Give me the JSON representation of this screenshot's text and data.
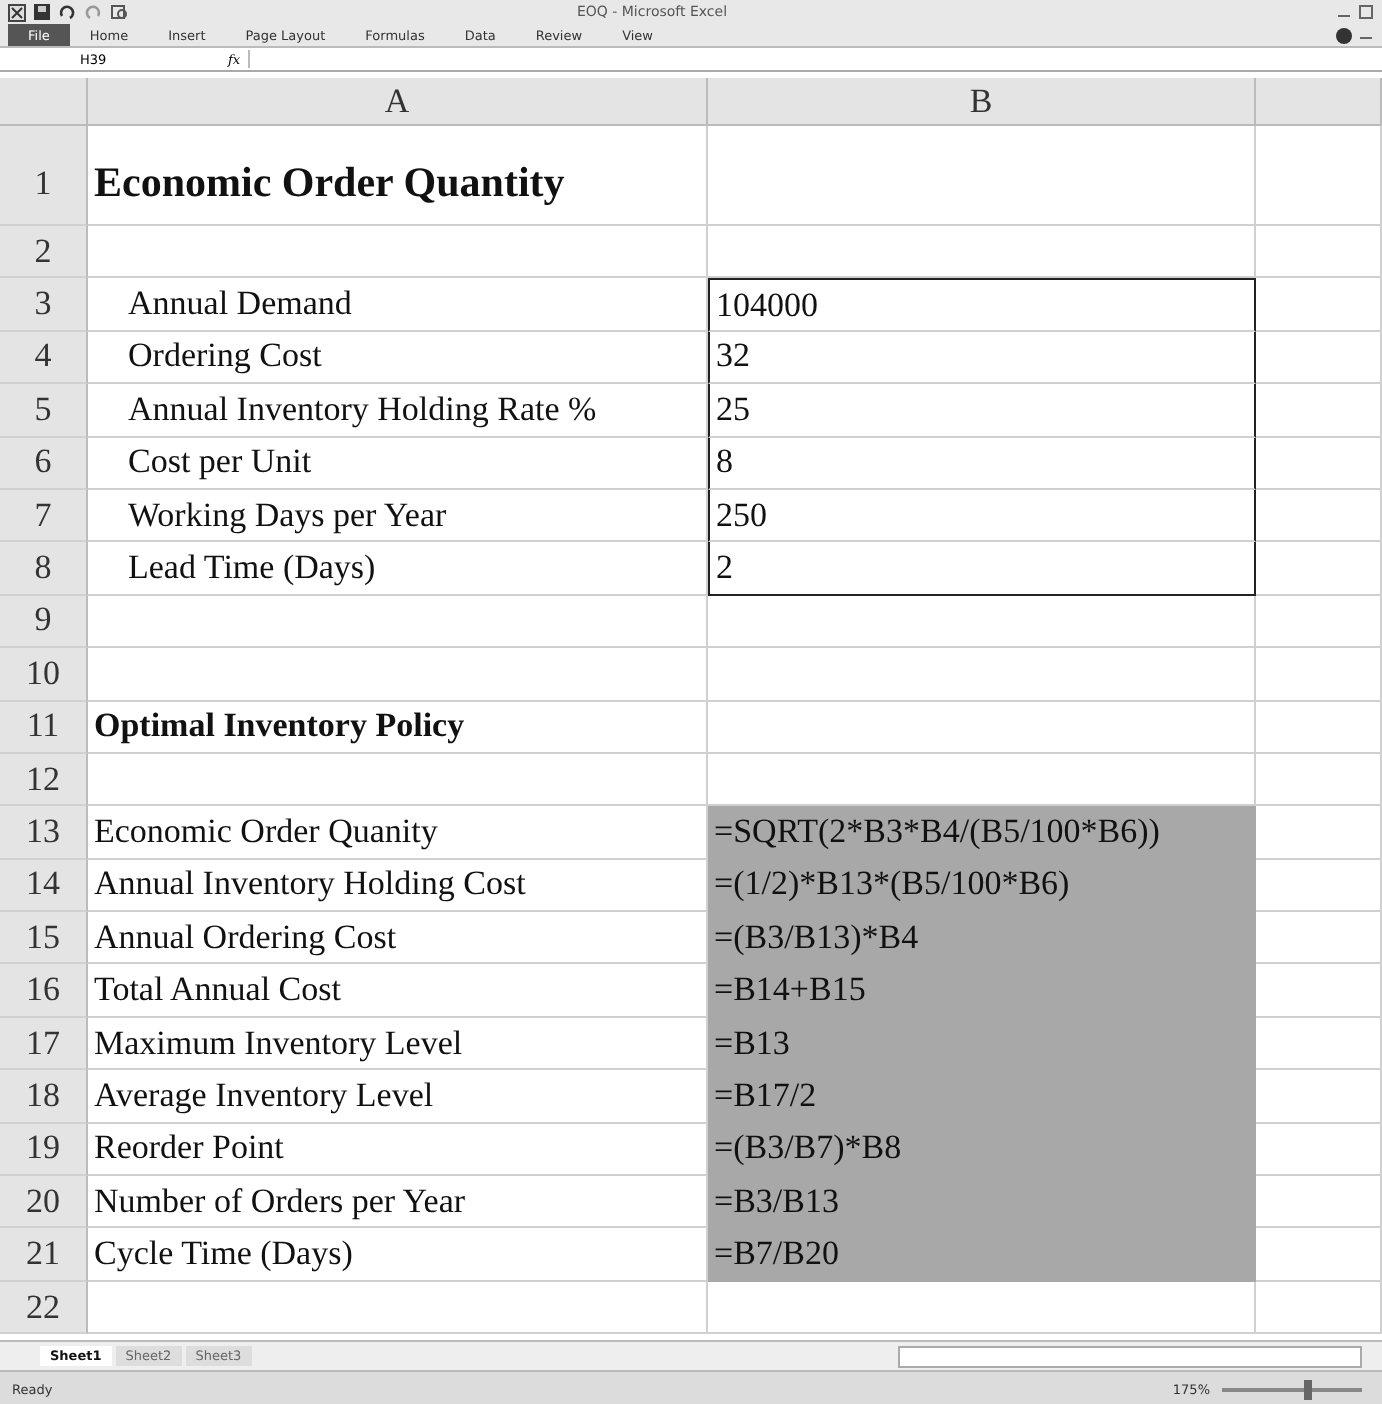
{
  "window": {
    "title": "EOQ - Microsoft Excel"
  },
  "ribbon_tabs": [
    {
      "label": "File",
      "selected": true
    },
    {
      "label": "Home",
      "selected": false
    },
    {
      "label": "Insert",
      "selected": false
    },
    {
      "label": "Page Layout",
      "selected": false
    },
    {
      "label": "Formulas",
      "selected": false
    },
    {
      "label": "Data",
      "selected": false
    },
    {
      "label": "Review",
      "selected": false
    },
    {
      "label": "View",
      "selected": false
    }
  ],
  "formula_bar": {
    "name_box": "H39",
    "fx": "fx"
  },
  "columns": [
    "A",
    "B"
  ],
  "rows": [
    {
      "number": "1",
      "kind": "title",
      "a": "Economic Order Quantity",
      "b": ""
    },
    {
      "number": "2",
      "kind": "blank",
      "a": "",
      "b": ""
    },
    {
      "number": "3",
      "kind": "input",
      "a": "Annual Demand",
      "b": "104000"
    },
    {
      "number": "4",
      "kind": "input",
      "a": "Ordering Cost",
      "b": "32"
    },
    {
      "number": "5",
      "kind": "input",
      "a": "Annual Inventory Holding Rate %",
      "b": "25"
    },
    {
      "number": "6",
      "kind": "input",
      "a": "Cost per Unit",
      "b": "8"
    },
    {
      "number": "7",
      "kind": "input",
      "a": "Working Days per Year",
      "b": "250"
    },
    {
      "number": "8",
      "kind": "input",
      "a": "Lead Time (Days)",
      "b": "2"
    },
    {
      "number": "9",
      "kind": "blank",
      "a": "",
      "b": ""
    },
    {
      "number": "10",
      "kind": "blank",
      "a": "",
      "b": ""
    },
    {
      "number": "11",
      "kind": "heading",
      "a": "Optimal Inventory Policy",
      "b": ""
    },
    {
      "number": "12",
      "kind": "blank",
      "a": "",
      "b": ""
    },
    {
      "number": "13",
      "kind": "output",
      "a": "Economic Order Quanity",
      "b": "=SQRT(2*B3*B4/(B5/100*B6))"
    },
    {
      "number": "14",
      "kind": "output",
      "a": "Annual Inventory Holding Cost",
      "b": "=(1/2)*B13*(B5/100*B6)"
    },
    {
      "number": "15",
      "kind": "output",
      "a": "Annual Ordering Cost",
      "b": "=(B3/B13)*B4"
    },
    {
      "number": "16",
      "kind": "output",
      "a": "Total Annual Cost",
      "b": "=B14+B15"
    },
    {
      "number": "17",
      "kind": "output",
      "a": "Maximum Inventory Level",
      "b": "=B13"
    },
    {
      "number": "18",
      "kind": "output",
      "a": "Average Inventory Level",
      "b": "=B17/2"
    },
    {
      "number": "19",
      "kind": "output",
      "a": "Reorder Point",
      "b": "=(B3/B7)*B8"
    },
    {
      "number": "20",
      "kind": "output",
      "a": "Number of Orders per Year",
      "b": "=B3/B13"
    },
    {
      "number": "21",
      "kind": "output",
      "a": "Cycle Time (Days)",
      "b": "=B7/B20"
    },
    {
      "number": "22",
      "kind": "blank",
      "a": "",
      "b": ""
    }
  ],
  "sheet_tabs": [
    {
      "label": "Sheet1",
      "selected": true
    },
    {
      "label": "Sheet2",
      "selected": false
    },
    {
      "label": "Sheet3",
      "selected": false
    }
  ],
  "status_bar": {
    "status": "Ready",
    "zoom": "175%",
    "zoom_slider": {
      "level": 0.62
    }
  }
}
